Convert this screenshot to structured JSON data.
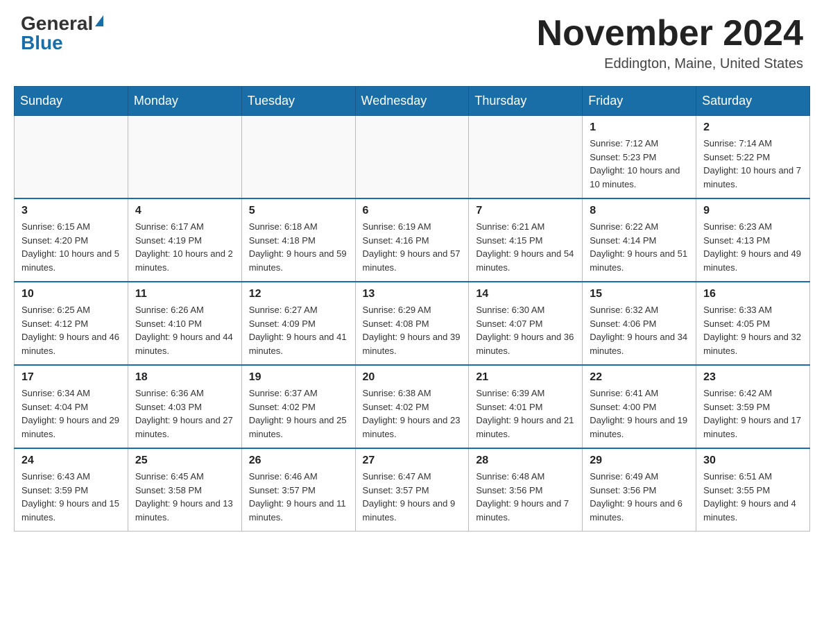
{
  "header": {
    "logo_general": "General",
    "logo_blue": "Blue",
    "month_title": "November 2024",
    "location": "Eddington, Maine, United States"
  },
  "days_of_week": [
    "Sunday",
    "Monday",
    "Tuesday",
    "Wednesday",
    "Thursday",
    "Friday",
    "Saturday"
  ],
  "weeks": [
    [
      {
        "day": "",
        "info": ""
      },
      {
        "day": "",
        "info": ""
      },
      {
        "day": "",
        "info": ""
      },
      {
        "day": "",
        "info": ""
      },
      {
        "day": "",
        "info": ""
      },
      {
        "day": "1",
        "info": "Sunrise: 7:12 AM\nSunset: 5:23 PM\nDaylight: 10 hours and 10 minutes."
      },
      {
        "day": "2",
        "info": "Sunrise: 7:14 AM\nSunset: 5:22 PM\nDaylight: 10 hours and 7 minutes."
      }
    ],
    [
      {
        "day": "3",
        "info": "Sunrise: 6:15 AM\nSunset: 4:20 PM\nDaylight: 10 hours and 5 minutes."
      },
      {
        "day": "4",
        "info": "Sunrise: 6:17 AM\nSunset: 4:19 PM\nDaylight: 10 hours and 2 minutes."
      },
      {
        "day": "5",
        "info": "Sunrise: 6:18 AM\nSunset: 4:18 PM\nDaylight: 9 hours and 59 minutes."
      },
      {
        "day": "6",
        "info": "Sunrise: 6:19 AM\nSunset: 4:16 PM\nDaylight: 9 hours and 57 minutes."
      },
      {
        "day": "7",
        "info": "Sunrise: 6:21 AM\nSunset: 4:15 PM\nDaylight: 9 hours and 54 minutes."
      },
      {
        "day": "8",
        "info": "Sunrise: 6:22 AM\nSunset: 4:14 PM\nDaylight: 9 hours and 51 minutes."
      },
      {
        "day": "9",
        "info": "Sunrise: 6:23 AM\nSunset: 4:13 PM\nDaylight: 9 hours and 49 minutes."
      }
    ],
    [
      {
        "day": "10",
        "info": "Sunrise: 6:25 AM\nSunset: 4:12 PM\nDaylight: 9 hours and 46 minutes."
      },
      {
        "day": "11",
        "info": "Sunrise: 6:26 AM\nSunset: 4:10 PM\nDaylight: 9 hours and 44 minutes."
      },
      {
        "day": "12",
        "info": "Sunrise: 6:27 AM\nSunset: 4:09 PM\nDaylight: 9 hours and 41 minutes."
      },
      {
        "day": "13",
        "info": "Sunrise: 6:29 AM\nSunset: 4:08 PM\nDaylight: 9 hours and 39 minutes."
      },
      {
        "day": "14",
        "info": "Sunrise: 6:30 AM\nSunset: 4:07 PM\nDaylight: 9 hours and 36 minutes."
      },
      {
        "day": "15",
        "info": "Sunrise: 6:32 AM\nSunset: 4:06 PM\nDaylight: 9 hours and 34 minutes."
      },
      {
        "day": "16",
        "info": "Sunrise: 6:33 AM\nSunset: 4:05 PM\nDaylight: 9 hours and 32 minutes."
      }
    ],
    [
      {
        "day": "17",
        "info": "Sunrise: 6:34 AM\nSunset: 4:04 PM\nDaylight: 9 hours and 29 minutes."
      },
      {
        "day": "18",
        "info": "Sunrise: 6:36 AM\nSunset: 4:03 PM\nDaylight: 9 hours and 27 minutes."
      },
      {
        "day": "19",
        "info": "Sunrise: 6:37 AM\nSunset: 4:02 PM\nDaylight: 9 hours and 25 minutes."
      },
      {
        "day": "20",
        "info": "Sunrise: 6:38 AM\nSunset: 4:02 PM\nDaylight: 9 hours and 23 minutes."
      },
      {
        "day": "21",
        "info": "Sunrise: 6:39 AM\nSunset: 4:01 PM\nDaylight: 9 hours and 21 minutes."
      },
      {
        "day": "22",
        "info": "Sunrise: 6:41 AM\nSunset: 4:00 PM\nDaylight: 9 hours and 19 minutes."
      },
      {
        "day": "23",
        "info": "Sunrise: 6:42 AM\nSunset: 3:59 PM\nDaylight: 9 hours and 17 minutes."
      }
    ],
    [
      {
        "day": "24",
        "info": "Sunrise: 6:43 AM\nSunset: 3:59 PM\nDaylight: 9 hours and 15 minutes."
      },
      {
        "day": "25",
        "info": "Sunrise: 6:45 AM\nSunset: 3:58 PM\nDaylight: 9 hours and 13 minutes."
      },
      {
        "day": "26",
        "info": "Sunrise: 6:46 AM\nSunset: 3:57 PM\nDaylight: 9 hours and 11 minutes."
      },
      {
        "day": "27",
        "info": "Sunrise: 6:47 AM\nSunset: 3:57 PM\nDaylight: 9 hours and 9 minutes."
      },
      {
        "day": "28",
        "info": "Sunrise: 6:48 AM\nSunset: 3:56 PM\nDaylight: 9 hours and 7 minutes."
      },
      {
        "day": "29",
        "info": "Sunrise: 6:49 AM\nSunset: 3:56 PM\nDaylight: 9 hours and 6 minutes."
      },
      {
        "day": "30",
        "info": "Sunrise: 6:51 AM\nSunset: 3:55 PM\nDaylight: 9 hours and 4 minutes."
      }
    ]
  ]
}
